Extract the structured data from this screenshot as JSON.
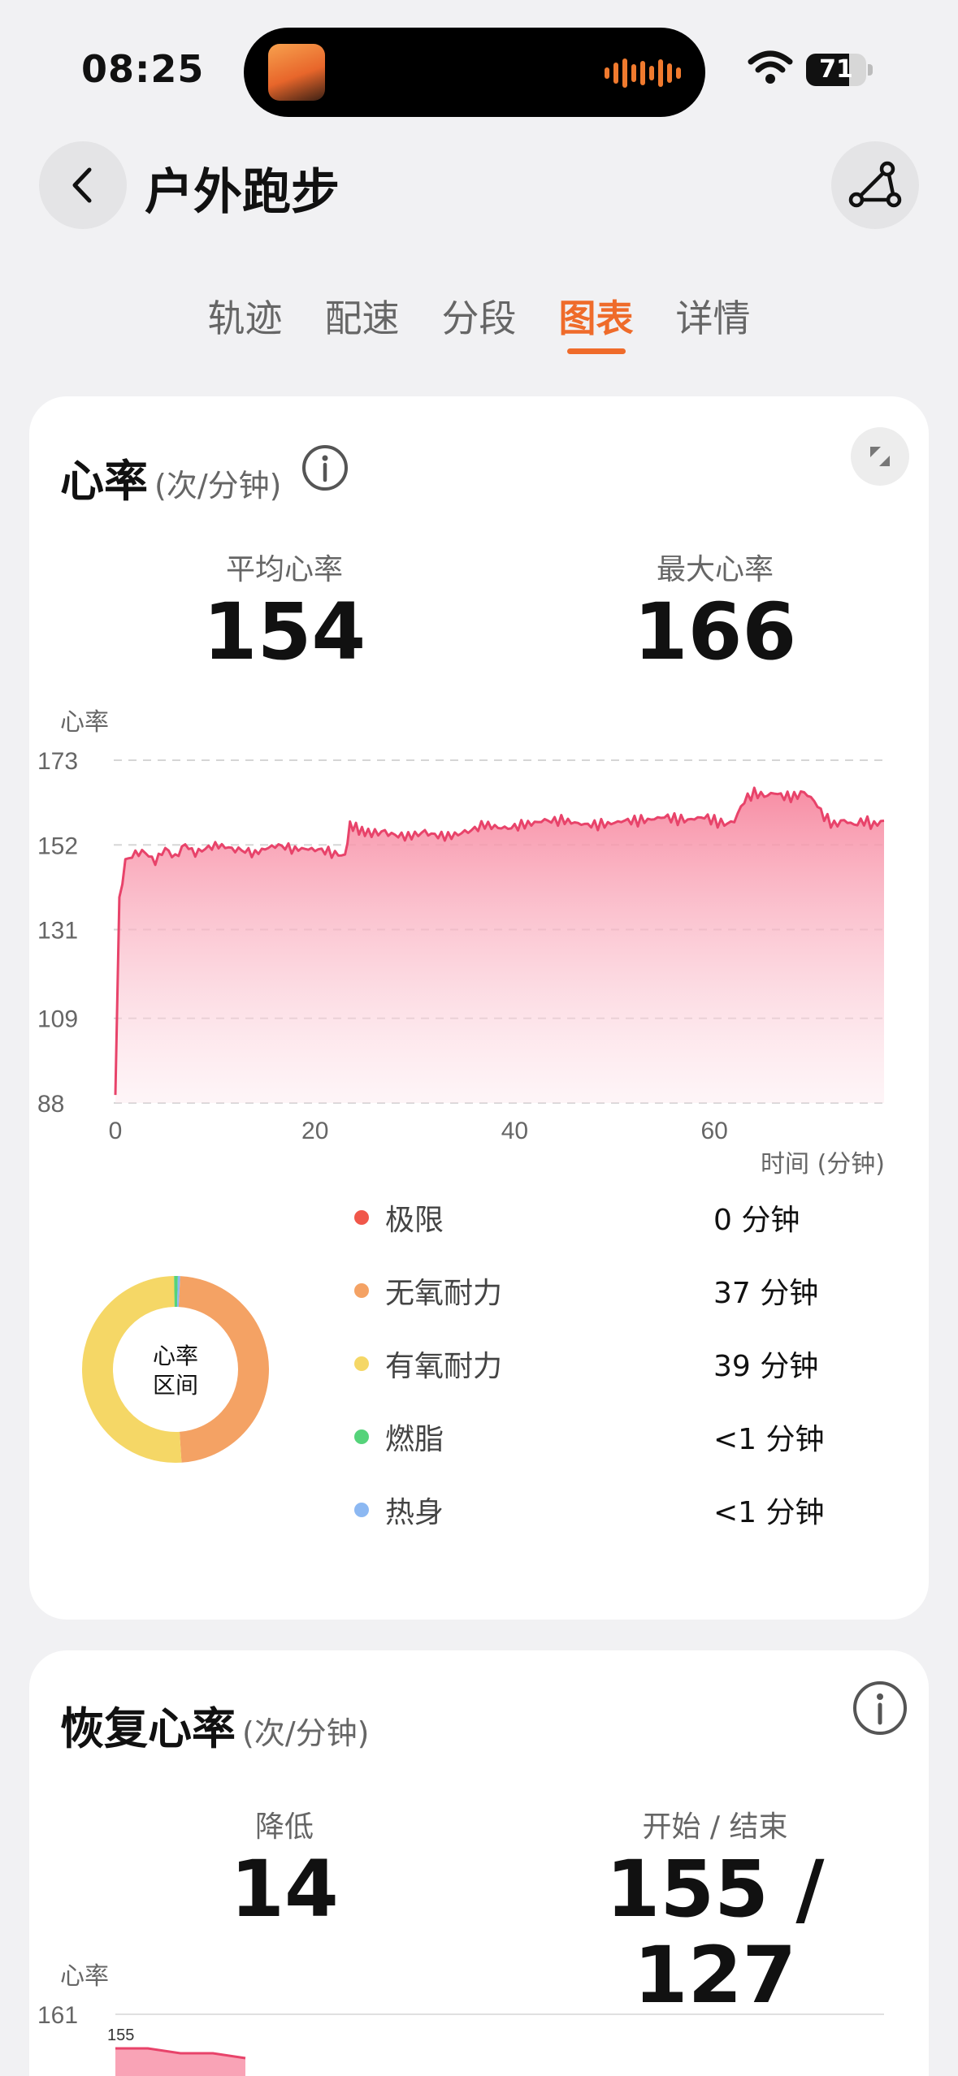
{
  "status": {
    "time": "08:25",
    "battery": "71"
  },
  "header": {
    "title": "户外跑步"
  },
  "tabs": [
    {
      "label": "轨迹",
      "active": false
    },
    {
      "label": "配速",
      "active": false
    },
    {
      "label": "分段",
      "active": false
    },
    {
      "label": "图表",
      "active": true
    },
    {
      "label": "详情",
      "active": false
    }
  ],
  "heart_rate": {
    "title": "心率",
    "unit": "(次/分钟)",
    "avg_label": "平均心率",
    "avg_value": "154",
    "max_label": "最大心率",
    "max_value": "166",
    "zone_center_label_1": "心率",
    "zone_center_label_2": "区间",
    "zones": [
      {
        "label": "极限",
        "value": "0 分钟",
        "color": "#f0574a",
        "minutes": 0
      },
      {
        "label": "无氧耐力",
        "value": "37 分钟",
        "color": "#f4a264",
        "minutes": 37
      },
      {
        "label": "有氧耐力",
        "value": "39 分钟",
        "color": "#f5d766",
        "minutes": 39
      },
      {
        "label": "燃脂",
        "value": "<1 分钟",
        "color": "#55d37a",
        "minutes": 0.5
      },
      {
        "label": "热身",
        "value": "<1 分钟",
        "color": "#8cb8f2",
        "minutes": 0.3
      }
    ]
  },
  "recovery": {
    "title": "恢复心率",
    "unit": "(次/分钟)",
    "drop_label": "降低",
    "drop_value": "14",
    "start_end_label": "开始 / 结束",
    "start_end_value": "155 / 127"
  },
  "chart_data": [
    {
      "type": "area",
      "ylabel": "心率",
      "xlabel": "时间 (分钟)",
      "y_ticks": [
        "173",
        "152",
        "131",
        "109",
        "88"
      ],
      "x_ticks": [
        "0",
        "20",
        "40",
        "60"
      ],
      "ylim": [
        88,
        173
      ],
      "xlim": [
        0,
        77
      ],
      "grid": true,
      "color": "#e8436a",
      "x": [
        0,
        0.4,
        1,
        2,
        3,
        4,
        5,
        6,
        7,
        8,
        9,
        10,
        12,
        14,
        16,
        18,
        20,
        22,
        23,
        23.5,
        25,
        27,
        29,
        31,
        33,
        35,
        37,
        39,
        41,
        43,
        45,
        47,
        49,
        51,
        53,
        55,
        57,
        59,
        61,
        62,
        63,
        64,
        65,
        66,
        67,
        68,
        69,
        70,
        71,
        72,
        73,
        74,
        75,
        76,
        77
      ],
      "y": [
        90,
        138,
        148,
        150,
        150,
        148,
        151,
        149,
        152,
        150,
        151,
        152,
        151,
        150,
        152,
        151,
        151,
        150,
        149,
        157,
        155,
        155,
        154,
        155,
        154,
        155,
        157,
        156,
        157,
        158,
        158,
        157,
        157,
        158,
        158,
        159,
        158,
        159,
        157,
        158,
        163,
        165,
        164,
        165,
        164,
        164,
        165,
        163,
        159,
        157,
        158,
        157,
        158,
        157,
        158
      ]
    },
    {
      "type": "area",
      "ylabel": "心率",
      "y_ticks": [
        "161"
      ],
      "annotations": [
        "155"
      ],
      "color": "#e8436a",
      "x": [
        0,
        1,
        2,
        3,
        4
      ],
      "y": [
        155,
        155,
        154,
        154,
        153
      ]
    }
  ]
}
